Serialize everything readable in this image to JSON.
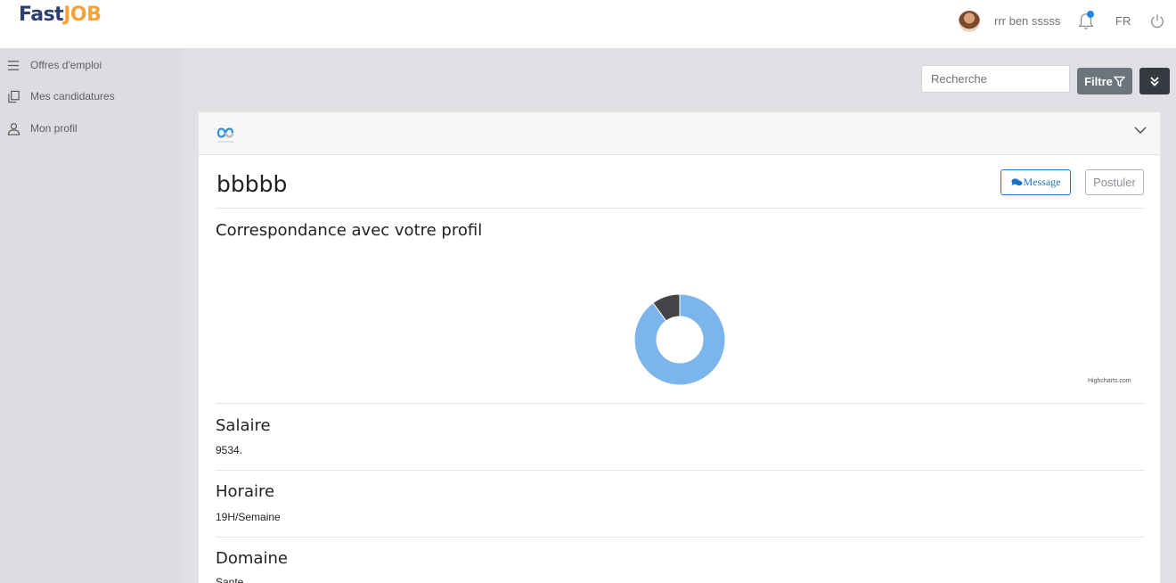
{
  "brand": {
    "part1": "Fast",
    "part2": "JOB"
  },
  "header": {
    "username": "rrr ben sssss",
    "language": "FR"
  },
  "sidebar": {
    "items": [
      {
        "label": "Offres d'emploi",
        "icon": "menu-icon"
      },
      {
        "label": "Mes candidatures",
        "icon": "documents-icon"
      },
      {
        "label": "Mon profil",
        "icon": "user-icon"
      }
    ]
  },
  "toolbar": {
    "search_placeholder": "Recherche",
    "filter_label": "Filtre"
  },
  "offer": {
    "title": "bbbbb",
    "message_label": "Message",
    "apply_label": "Postuler",
    "match_title": "Correspondance avec votre profil",
    "credits": "Highcharts.com",
    "salary_title": "Salaire",
    "salary_value": "9534.",
    "hours_title": "Horaire",
    "hours_value": "19H/Semaine",
    "domain_title": "Domaine",
    "domain_value": "Sante"
  },
  "colors": {
    "match": "#7cb5ec",
    "mismatch": "#434348"
  },
  "chart_data": {
    "type": "pie",
    "series": [
      {
        "values": [
          90,
          10
        ]
      }
    ]
  }
}
